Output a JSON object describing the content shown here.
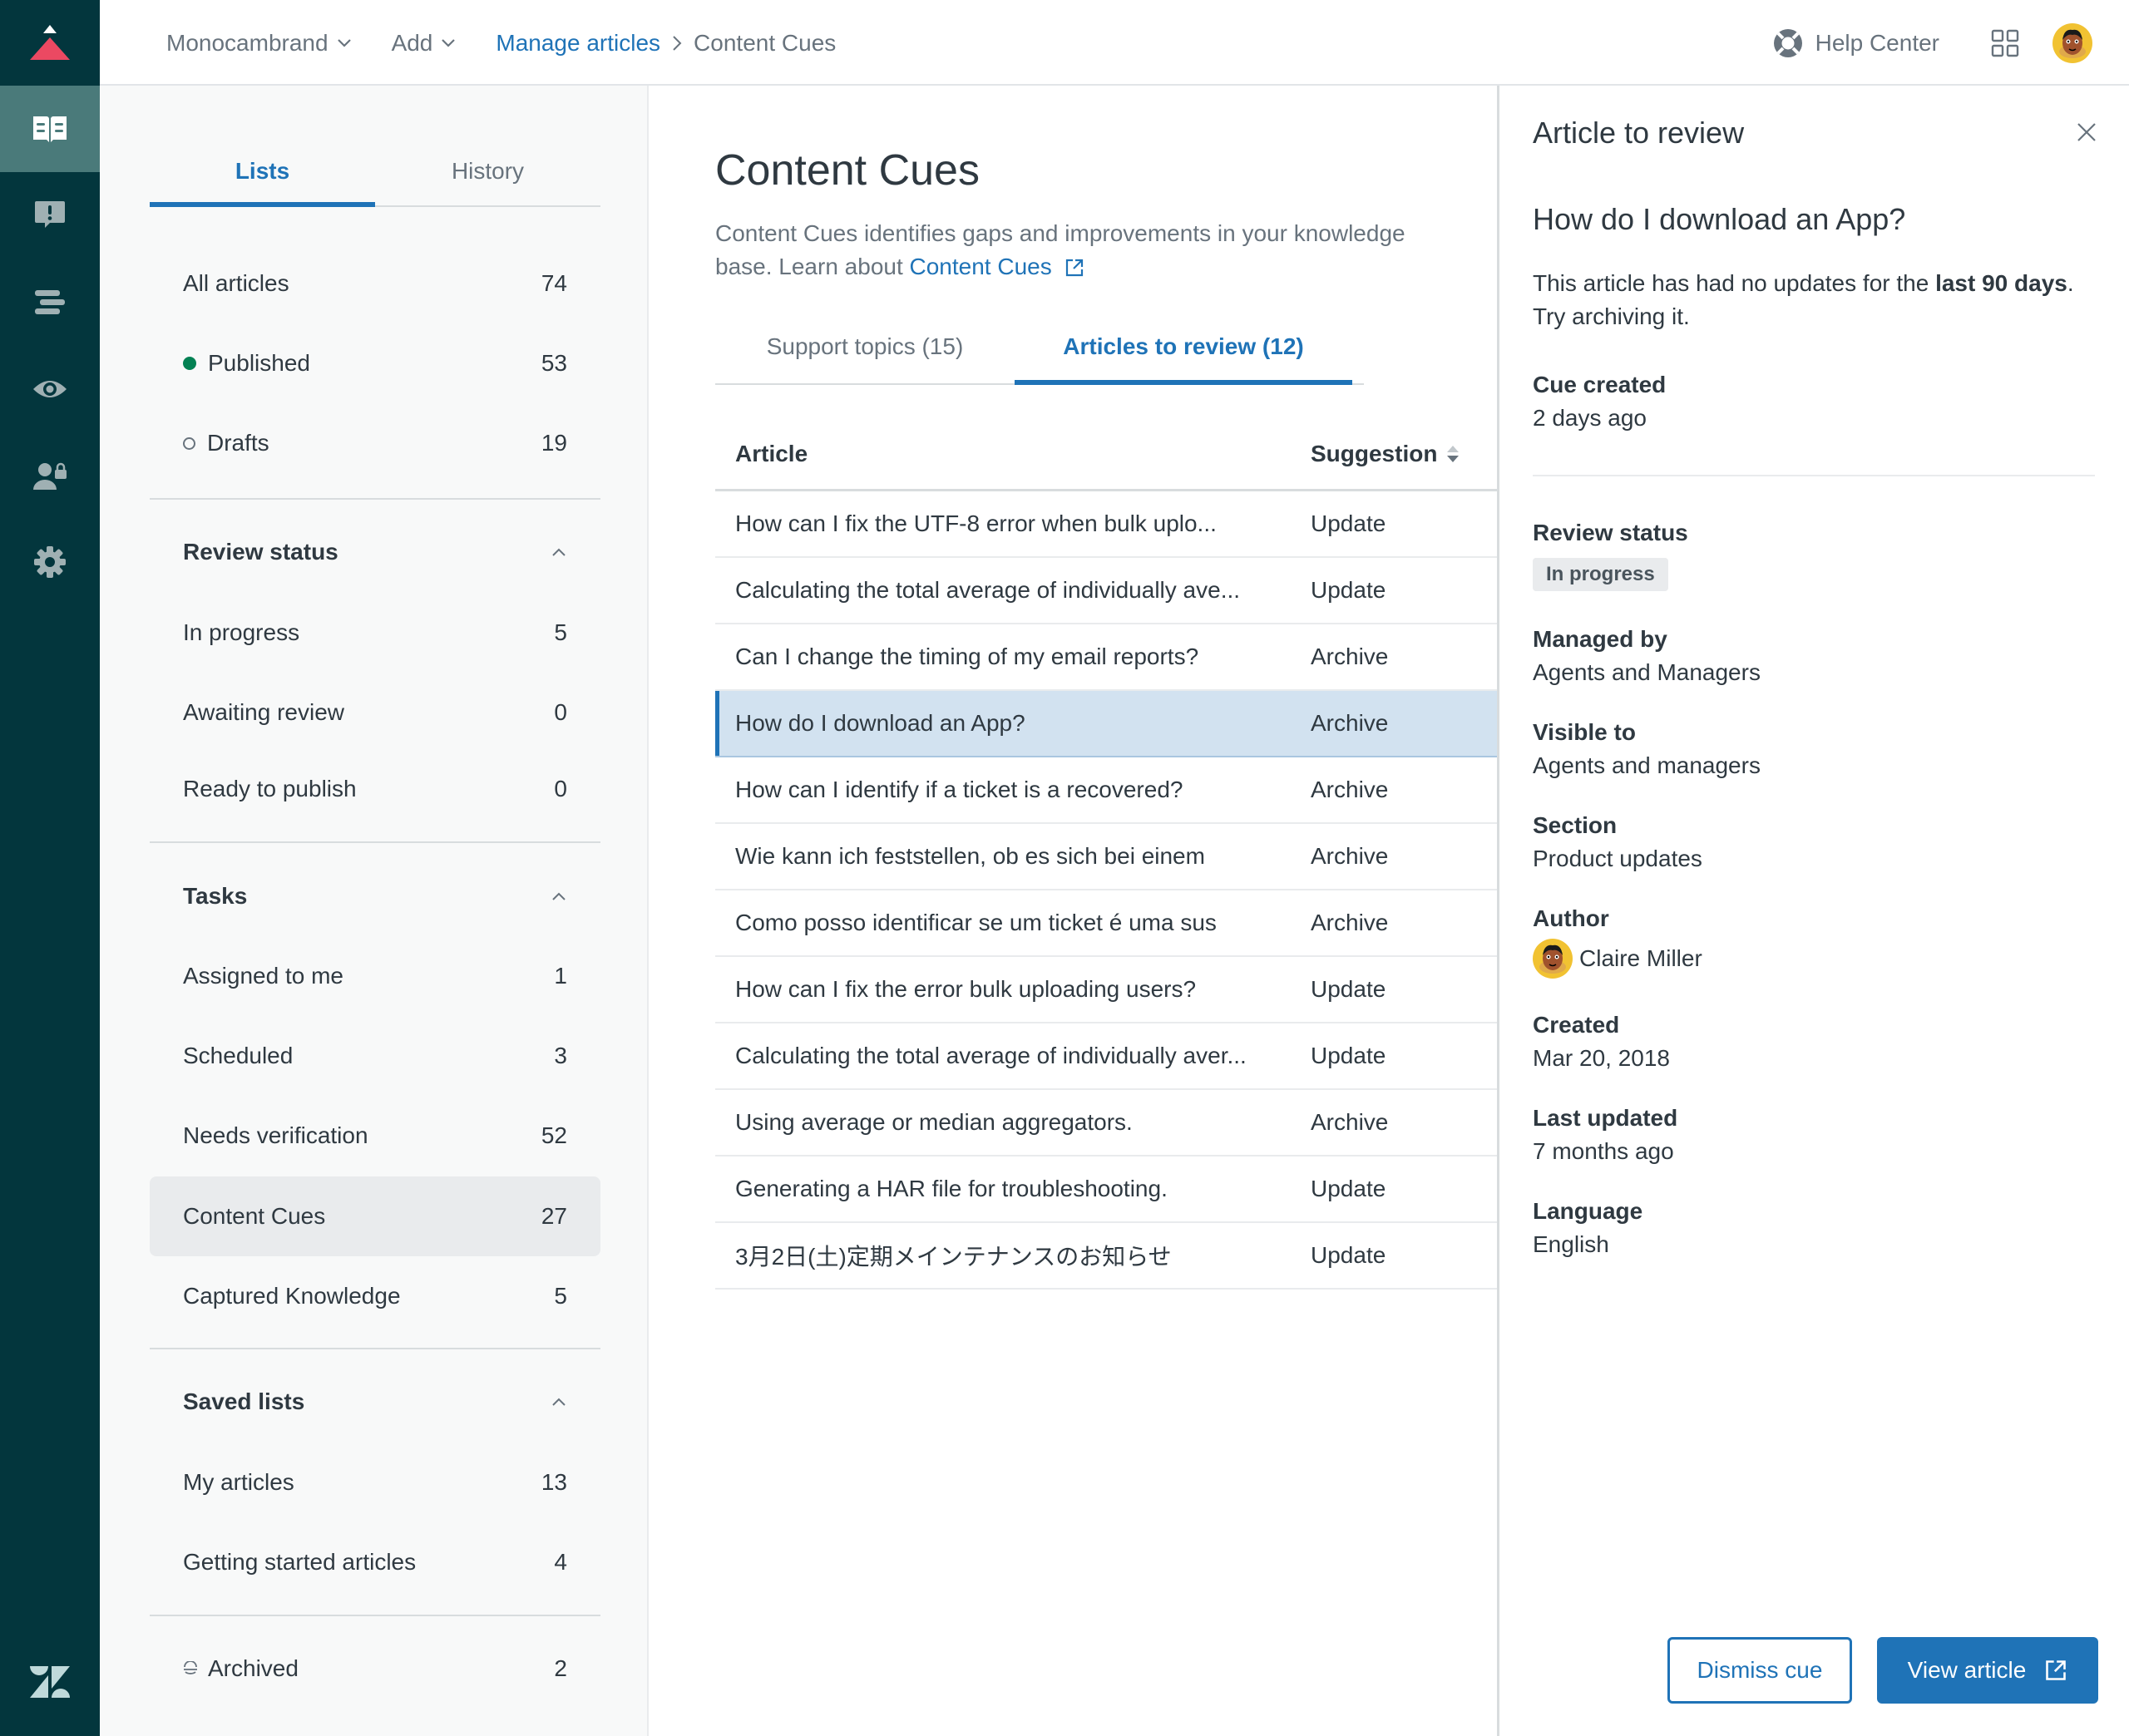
{
  "nav_rail": {
    "items": [
      {
        "name": "guide-icon",
        "active": true
      },
      {
        "name": "feedback-icon",
        "active": false
      },
      {
        "name": "arrange-icon",
        "active": false
      },
      {
        "name": "preview-icon",
        "active": false
      },
      {
        "name": "permissions-icon",
        "active": false
      },
      {
        "name": "settings-icon",
        "active": false
      }
    ]
  },
  "header": {
    "brand_dropdown": "Monocambrand",
    "add_dropdown": "Add",
    "breadcrumb": {
      "parent": "Manage articles",
      "current": "Content Cues"
    },
    "help_center": "Help Center"
  },
  "left_panel": {
    "tabs": [
      {
        "label": "Lists",
        "active": true
      },
      {
        "label": "History",
        "active": false
      }
    ],
    "main_lists": [
      {
        "label": "All articles",
        "count": "74",
        "marker": "none"
      },
      {
        "label": "Published",
        "count": "53",
        "marker": "published-dot"
      },
      {
        "label": "Drafts",
        "count": "19",
        "marker": "draft-dot"
      }
    ],
    "review_status": {
      "heading": "Review status",
      "items": [
        {
          "label": "In progress",
          "count": "5"
        },
        {
          "label": "Awaiting review",
          "count": "0"
        },
        {
          "label": "Ready to publish",
          "count": "0"
        }
      ]
    },
    "tasks": {
      "heading": "Tasks",
      "items": [
        {
          "label": "Assigned to me",
          "count": "1"
        },
        {
          "label": "Scheduled",
          "count": "3"
        },
        {
          "label": "Needs verification",
          "count": "52"
        },
        {
          "label": "Content Cues",
          "count": "27",
          "selected": true
        },
        {
          "label": "Captured Knowledge",
          "count": "5"
        }
      ]
    },
    "saved_lists": {
      "heading": "Saved lists",
      "items": [
        {
          "label": "My articles",
          "count": "13"
        },
        {
          "label": "Getting started articles",
          "count": "4"
        }
      ]
    },
    "archived": {
      "label": "Archived",
      "count": "2"
    }
  },
  "main": {
    "title": "Content Cues",
    "description_prefix": "Content Cues identifies gaps and improvements in your knowledge base. Learn about ",
    "description_link": "Content Cues",
    "tabs": [
      {
        "label": "Support topics (15)",
        "active": false
      },
      {
        "label": "Articles to review (12)",
        "active": true
      }
    ],
    "table": {
      "columns": [
        "Article",
        "Suggestion"
      ],
      "rows": [
        {
          "article": "How can I fix the UTF-8 error when bulk uplo...",
          "suggestion": "Update"
        },
        {
          "article": "Calculating the total average of individually ave...",
          "suggestion": "Update"
        },
        {
          "article": "Can I change the timing of my email reports?",
          "suggestion": "Archive"
        },
        {
          "article": "How do I download an App?",
          "suggestion": "Archive",
          "selected": true
        },
        {
          "article": "How can I identify if a ticket is a recovered?",
          "suggestion": "Archive"
        },
        {
          "article": "Wie kann ich feststellen, ob es sich bei einem",
          "suggestion": "Archive"
        },
        {
          "article": "Como posso identificar se um ticket é uma sus",
          "suggestion": "Archive"
        },
        {
          "article": "How can I fix the error bulk uploading users?",
          "suggestion": "Update"
        },
        {
          "article": "Calculating the total average of individually aver...",
          "suggestion": "Update"
        },
        {
          "article": "Using average or median aggregators.",
          "suggestion": "Archive"
        },
        {
          "article": "Generating a HAR file for troubleshooting.",
          "suggestion": "Update"
        },
        {
          "article": "3月2日(土)定期メインテナンスのお知らせ",
          "suggestion": "Update"
        }
      ]
    }
  },
  "detail_panel": {
    "title": "Article to review",
    "article_title": "How do I download an App?",
    "message_prefix": "This article has had no updates for the ",
    "message_bold": "last 90 days",
    "message_suffix": ". Try archiving it.",
    "cue_created": {
      "label": "Cue created",
      "value": "2 days ago"
    },
    "review_status": {
      "label": "Review status",
      "value": "In progress"
    },
    "managed_by": {
      "label": "Managed by",
      "value": "Agents and Managers"
    },
    "visible_to": {
      "label": "Visible to",
      "value": "Agents and managers"
    },
    "section": {
      "label": "Section",
      "value": "Product updates"
    },
    "author": {
      "label": "Author",
      "value": "Claire Miller"
    },
    "created": {
      "label": "Created",
      "value": "Mar 20, 2018"
    },
    "last_updated": {
      "label": "Last updated",
      "value": "7 months ago"
    },
    "language": {
      "label": "Language",
      "value": "English"
    },
    "dismiss_button": "Dismiss cue",
    "view_button": "View article"
  },
  "colors": {
    "rail_bg": "#03363d",
    "rail_active": "#4a7a7a",
    "accent_blue": "#1f73b7",
    "published_green": "#038153",
    "selected_row_bg": "#d2e2f0",
    "logo_red": "#eb4962"
  }
}
